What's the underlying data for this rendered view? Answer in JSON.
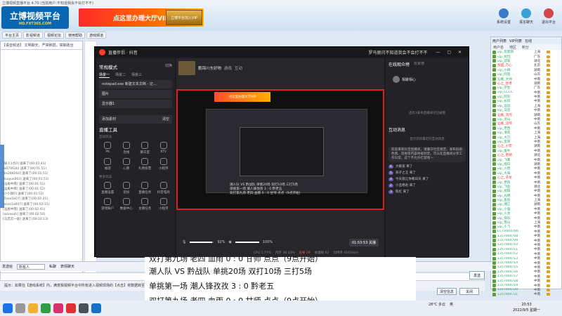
{
  "window": {
    "title": "立博视频直播平台 4.70 (当前用户:不知道我会不会打不不)"
  },
  "banner": {
    "logo_main": "立博视频平台",
    "logo_url": "HD.FXT365.COM",
    "vip_text": "点这里办理大厅VIP",
    "gold_text": "立博平台加入VIP",
    "top_buttons": [
      {
        "label": "系统设置",
        "color": "#3a78c8"
      },
      {
        "label": "语言聊天",
        "color": "#3aa0d8"
      },
      {
        "label": "退出平台",
        "color": "#d04848"
      }
    ]
  },
  "tabs": [
    "平台主页",
    "影视频道",
    "视频论坛",
    "使用帮助",
    "游戏频道"
  ],
  "left_panel": {
    "header": "【语音频道】 文明聊天，严禁刷屏，禁聊政治",
    "chat_lines": [
      "[秘人1点0] 送来了(00:01:41)",
      "[a07062b] 送来了(00:01:51)",
      "[bs284264] 送来了(00:01:51)",
      "[luoyus003] 送来了(00:01:51)",
      "[汕尾中南] 送来了(00:01:51)",
      "[汕尾中南] 送来了(00:01:52)",
      "[小小刚0] 送来了(00:01:52)",
      "[5sxx1b07] 送来了(00:02:31)",
      "[asxs1a007] 送来了(00:02:31)",
      "[汕尾中南] 送来了(00:02:41)",
      "[asxxsoh] 送来了(00:02:50)",
      "[马忠云一级] 送来了(00:03:13)"
    ]
  },
  "send_bar": {
    "label": "发送给",
    "target": "所有人",
    "private_label": "私聊",
    "voice_label": "表情聊天",
    "send_button": "发送"
  },
  "bottom_tip": "提示：如果在【游戏系统】内，满意我视频平台中所有进入视频现场的【点击】将数据转至下方，推荐个人支持",
  "bottom_buttons": [
    "清空信息",
    "关闭"
  ],
  "user_list": {
    "tabs": [
      "用户列表",
      "VIP列表",
      "在线"
    ],
    "columns": [
      "用户名",
      "地区",
      "积分"
    ],
    "users": [
      {
        "name": "vip_玩客网",
        "region": "上海",
        "color": "#2a6"
      },
      {
        "name": "vip_龙玩",
        "region": "广东",
        "color": "#2a6"
      },
      {
        "name": "vip_冠军",
        "region": "湖北",
        "color": "#2a6"
      },
      {
        "name": "加盟_万心",
        "region": "北京",
        "color": "#e33"
      },
      {
        "name": "vip_小刚",
        "region": "湖南",
        "color": "#2a6"
      },
      {
        "name": "vip_阿浩",
        "region": "山东",
        "color": "#2a6"
      },
      {
        "name": "汕尾_大帅",
        "region": "中南",
        "color": "#2a6"
      },
      {
        "name": "心之_甘肃",
        "region": "湖南",
        "color": "#e33"
      },
      {
        "name": "vip_学生",
        "region": "广东",
        "color": "#2a6"
      },
      {
        "name": "vip_CCCC",
        "region": "中南",
        "color": "#2a6"
      },
      {
        "name": "vip_阿东",
        "region": "中南",
        "color": "#2a6"
      },
      {
        "name": "vip_长风",
        "region": "中南",
        "color": "#2a6"
      },
      {
        "name": "vip_远远",
        "region": "上海",
        "color": "#2a6"
      },
      {
        "name": "vip_马忠",
        "region": "中南",
        "color": "#2a6"
      },
      {
        "name": "汕尾_流河",
        "region": "湖南",
        "color": "#e33"
      },
      {
        "name": "vip_灵山",
        "region": "中南",
        "color": "#2a6"
      },
      {
        "name": "汕尾_汪阿",
        "region": "山东",
        "color": "#e33"
      },
      {
        "name": "vip_老西",
        "region": "中南",
        "color": "#2a6"
      },
      {
        "name": "vip_清风",
        "region": "上海",
        "color": "#2a6"
      },
      {
        "name": "vip_大刀",
        "region": "上海",
        "color": "#2a6"
      },
      {
        "name": "vip_宝哥",
        "region": "中南",
        "color": "#2a6"
      },
      {
        "name": "心之_小宏",
        "region": "湖南",
        "color": "#e33"
      },
      {
        "name": "vip_金牛",
        "region": "中南",
        "color": "#2a6"
      },
      {
        "name": "心之_老胡",
        "region": "湖北",
        "color": "#e33"
      },
      {
        "name": "vip_飞鹰",
        "region": "中南",
        "color": "#2a6"
      },
      {
        "name": "vip_旭日",
        "region": "湖南",
        "color": "#2a6"
      },
      {
        "name": "vip_火炬",
        "region": "中南",
        "color": "#2a6"
      },
      {
        "name": "vip_大海",
        "region": "中南",
        "color": "#2a6"
      },
      {
        "name": "心之_子龙",
        "region": "中南",
        "color": "#e33"
      },
      {
        "name": "vip_老四",
        "region": "中南",
        "color": "#2a6"
      },
      {
        "name": "vip_飞鱼",
        "region": "湖北",
        "color": "#2a6"
      },
      {
        "name": "vip_旭阳",
        "region": "中南",
        "color": "#2a6"
      },
      {
        "name": "vip_光明",
        "region": "中南",
        "color": "#2a6"
      },
      {
        "name": "vip_鱼鱼",
        "region": "上海",
        "color": "#2a6"
      },
      {
        "name": "vip_湘江",
        "region": "湖南",
        "color": "#2a6"
      },
      {
        "name": "vip_小强",
        "region": "中南",
        "color": "#2a6"
      },
      {
        "name": "vip_火龙",
        "region": "中南",
        "color": "#2a6"
      },
      {
        "name": "vip_快乐",
        "region": "中南",
        "color": "#2a6"
      },
      {
        "name": "vip_雪山",
        "region": "上海",
        "color": "#2a6"
      },
      {
        "name": "vip_小飞",
        "region": "中南",
        "color": "#2a6"
      },
      {
        "name": "CCTV004786",
        "region": "中南",
        "color": "#2a6"
      },
      {
        "name": "1357004708",
        "region": "中南",
        "color": "#2a6"
      },
      {
        "name": "1357004709",
        "region": "中南",
        "color": "#2a6"
      },
      {
        "name": "1357004710",
        "region": "中南",
        "color": "#2a6"
      },
      {
        "name": "1357004711",
        "region": "中南",
        "color": "#2a6"
      },
      {
        "name": "1357004712",
        "region": "中南",
        "color": "#2a6"
      },
      {
        "name": "1357004713",
        "region": "中南",
        "color": "#2a6"
      },
      {
        "name": "1357004714",
        "region": "中南",
        "color": "#2a6"
      },
      {
        "name": "1357004715",
        "region": "中南",
        "color": "#2a6"
      },
      {
        "name": "1357004716",
        "region": "中南",
        "color": "#2a6"
      },
      {
        "name": "1357004717",
        "region": "中南",
        "color": "#2a6"
      },
      {
        "name": "1357004718",
        "region": "中南",
        "color": "#2a6"
      },
      {
        "name": "1357004719",
        "region": "中南",
        "color": "#2a6"
      },
      {
        "name": "1357004720",
        "region": "中南",
        "color": "#2a6"
      },
      {
        "name": "1357004721",
        "region": "中南",
        "color": "#2a6"
      }
    ]
  },
  "obs": {
    "app_name": "直播伴侣 · 抖音",
    "user": "罗马丽闪不知道我会不会打不不",
    "mode_title": "常规模式",
    "mode_action": "切换",
    "scene_tabs": [
      "场景一",
      "场景二",
      "场景三"
    ],
    "sources": [
      "notepad.exe 新建文本文档 - 记...",
      "图片",
      "显示器1"
    ],
    "add_source": "添加素材",
    "add_source_action": "清空",
    "tools_title": "直播工具",
    "tools_sub1": "互动玩法",
    "tools": [
      "PK",
      "连线",
      "聊天室",
      "KTV",
      "福袋",
      "心愿",
      "礼物投票",
      "小程序"
    ],
    "tools_sub2": "更多玩法",
    "tools2": [
      "直播设置",
      "装扮",
      "直播任务",
      "抖音电商",
      "游戏账户",
      "数据中心",
      "主播任务",
      "小程序"
    ],
    "room_title": "鹏锦川东好物",
    "room_tags": [
      "游戏",
      "互动"
    ],
    "preview": {
      "banner": "点这里办理大厅VIP",
      "line1": "潮人队 VS 黔战队       单挑20场  双打10场  三打5场",
      "line2": "单挑第一场   潮人锋孜孜   3 : 0  黔老五",
      "line3": "双打第九场   老四  血雨   0 : 0  甘师 点点（9点开始）"
    },
    "volume1": "92%",
    "volume2": "100%",
    "live_button": "01:53:53 关播",
    "stats": [
      "CPU 5.77%",
      "内存 36.43%",
      "丢帧 29",
      "关键帧 62",
      "比特率 4165kb/s"
    ],
    "right_tabs": [
      "在线观众榜",
      "玩家榜"
    ],
    "viewer_name": "相聚相心",
    "viewer_count_text": "还有1来本直播间守已被围",
    "interaction_title": "互动消息",
    "interaction_sub": "显示您的最近的互动消息",
    "sys_message": "欢迎来到抖音直播间，请遵守社区规范，发布低俗色情、违规等内容将被封禁。可以在直播间分享工作日常，这个不允许打游戏～",
    "entries": [
      {
        "badge": "6",
        "text": "大碗宽 来了"
      },
      {
        "badge": "5",
        "text": "孩子之王 来了"
      },
      {
        "badge": "4",
        "text": "今天就让你看日天 来了"
      },
      {
        "badge": "2",
        "text": "小丑杨毛 来了"
      },
      {
        "badge": "3",
        "text": "陈红 来了"
      }
    ]
  },
  "caption": {
    "line0": "双打第九场    老四  血雨    0 : 0    甘师 点点（9点开始）",
    "line1": "潮人队 VS 黔战队            单挑20场    双打10场    三打5场",
    "line2": "单挑第一场      潮人锋孜孜    3  :  0   黔老五",
    "line3": "双打第九场      老四  血雨     0 : 0    甘师 点点（9点开始）"
  },
  "taskbar": {
    "weather": "28°C 多云",
    "time": "20:53",
    "date": "2022/9/5 星期一",
    "tray_lang": "英"
  }
}
